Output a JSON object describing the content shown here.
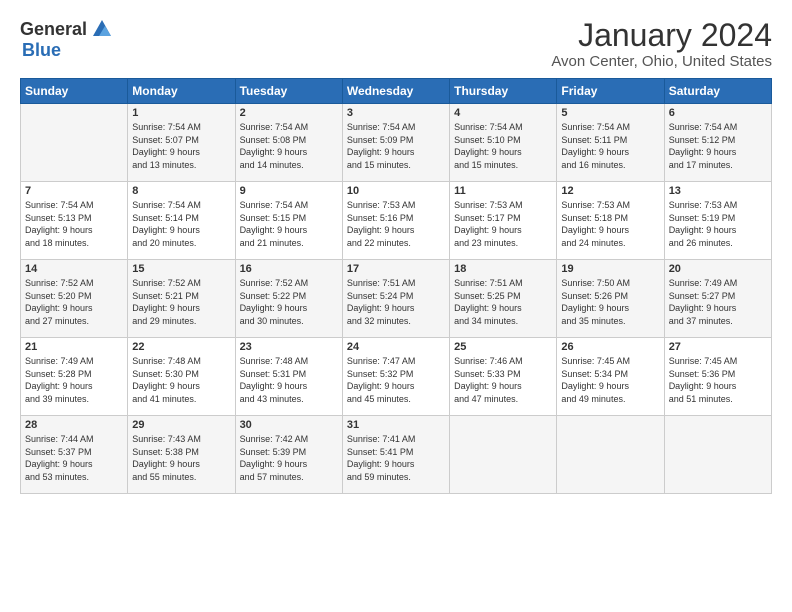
{
  "logo": {
    "general": "General",
    "blue": "Blue"
  },
  "title": "January 2024",
  "location": "Avon Center, Ohio, United States",
  "days_of_week": [
    "Sunday",
    "Monday",
    "Tuesday",
    "Wednesday",
    "Thursday",
    "Friday",
    "Saturday"
  ],
  "weeks": [
    [
      {
        "day": "",
        "sunrise": "",
        "sunset": "",
        "daylight": ""
      },
      {
        "day": "1",
        "sunrise": "Sunrise: 7:54 AM",
        "sunset": "Sunset: 5:07 PM",
        "daylight": "Daylight: 9 hours and 13 minutes."
      },
      {
        "day": "2",
        "sunrise": "Sunrise: 7:54 AM",
        "sunset": "Sunset: 5:08 PM",
        "daylight": "Daylight: 9 hours and 14 minutes."
      },
      {
        "day": "3",
        "sunrise": "Sunrise: 7:54 AM",
        "sunset": "Sunset: 5:09 PM",
        "daylight": "Daylight: 9 hours and 15 minutes."
      },
      {
        "day": "4",
        "sunrise": "Sunrise: 7:54 AM",
        "sunset": "Sunset: 5:10 PM",
        "daylight": "Daylight: 9 hours and 15 minutes."
      },
      {
        "day": "5",
        "sunrise": "Sunrise: 7:54 AM",
        "sunset": "Sunset: 5:11 PM",
        "daylight": "Daylight: 9 hours and 16 minutes."
      },
      {
        "day": "6",
        "sunrise": "Sunrise: 7:54 AM",
        "sunset": "Sunset: 5:12 PM",
        "daylight": "Daylight: 9 hours and 17 minutes."
      }
    ],
    [
      {
        "day": "7",
        "sunrise": "Sunrise: 7:54 AM",
        "sunset": "Sunset: 5:13 PM",
        "daylight": "Daylight: 9 hours and 18 minutes."
      },
      {
        "day": "8",
        "sunrise": "Sunrise: 7:54 AM",
        "sunset": "Sunset: 5:14 PM",
        "daylight": "Daylight: 9 hours and 20 minutes."
      },
      {
        "day": "9",
        "sunrise": "Sunrise: 7:54 AM",
        "sunset": "Sunset: 5:15 PM",
        "daylight": "Daylight: 9 hours and 21 minutes."
      },
      {
        "day": "10",
        "sunrise": "Sunrise: 7:53 AM",
        "sunset": "Sunset: 5:16 PM",
        "daylight": "Daylight: 9 hours and 22 minutes."
      },
      {
        "day": "11",
        "sunrise": "Sunrise: 7:53 AM",
        "sunset": "Sunset: 5:17 PM",
        "daylight": "Daylight: 9 hours and 23 minutes."
      },
      {
        "day": "12",
        "sunrise": "Sunrise: 7:53 AM",
        "sunset": "Sunset: 5:18 PM",
        "daylight": "Daylight: 9 hours and 24 minutes."
      },
      {
        "day": "13",
        "sunrise": "Sunrise: 7:53 AM",
        "sunset": "Sunset: 5:19 PM",
        "daylight": "Daylight: 9 hours and 26 minutes."
      }
    ],
    [
      {
        "day": "14",
        "sunrise": "Sunrise: 7:52 AM",
        "sunset": "Sunset: 5:20 PM",
        "daylight": "Daylight: 9 hours and 27 minutes."
      },
      {
        "day": "15",
        "sunrise": "Sunrise: 7:52 AM",
        "sunset": "Sunset: 5:21 PM",
        "daylight": "Daylight: 9 hours and 29 minutes."
      },
      {
        "day": "16",
        "sunrise": "Sunrise: 7:52 AM",
        "sunset": "Sunset: 5:22 PM",
        "daylight": "Daylight: 9 hours and 30 minutes."
      },
      {
        "day": "17",
        "sunrise": "Sunrise: 7:51 AM",
        "sunset": "Sunset: 5:24 PM",
        "daylight": "Daylight: 9 hours and 32 minutes."
      },
      {
        "day": "18",
        "sunrise": "Sunrise: 7:51 AM",
        "sunset": "Sunset: 5:25 PM",
        "daylight": "Daylight: 9 hours and 34 minutes."
      },
      {
        "day": "19",
        "sunrise": "Sunrise: 7:50 AM",
        "sunset": "Sunset: 5:26 PM",
        "daylight": "Daylight: 9 hours and 35 minutes."
      },
      {
        "day": "20",
        "sunrise": "Sunrise: 7:49 AM",
        "sunset": "Sunset: 5:27 PM",
        "daylight": "Daylight: 9 hours and 37 minutes."
      }
    ],
    [
      {
        "day": "21",
        "sunrise": "Sunrise: 7:49 AM",
        "sunset": "Sunset: 5:28 PM",
        "daylight": "Daylight: 9 hours and 39 minutes."
      },
      {
        "day": "22",
        "sunrise": "Sunrise: 7:48 AM",
        "sunset": "Sunset: 5:30 PM",
        "daylight": "Daylight: 9 hours and 41 minutes."
      },
      {
        "day": "23",
        "sunrise": "Sunrise: 7:48 AM",
        "sunset": "Sunset: 5:31 PM",
        "daylight": "Daylight: 9 hours and 43 minutes."
      },
      {
        "day": "24",
        "sunrise": "Sunrise: 7:47 AM",
        "sunset": "Sunset: 5:32 PM",
        "daylight": "Daylight: 9 hours and 45 minutes."
      },
      {
        "day": "25",
        "sunrise": "Sunrise: 7:46 AM",
        "sunset": "Sunset: 5:33 PM",
        "daylight": "Daylight: 9 hours and 47 minutes."
      },
      {
        "day": "26",
        "sunrise": "Sunrise: 7:45 AM",
        "sunset": "Sunset: 5:34 PM",
        "daylight": "Daylight: 9 hours and 49 minutes."
      },
      {
        "day": "27",
        "sunrise": "Sunrise: 7:45 AM",
        "sunset": "Sunset: 5:36 PM",
        "daylight": "Daylight: 9 hours and 51 minutes."
      }
    ],
    [
      {
        "day": "28",
        "sunrise": "Sunrise: 7:44 AM",
        "sunset": "Sunset: 5:37 PM",
        "daylight": "Daylight: 9 hours and 53 minutes."
      },
      {
        "day": "29",
        "sunrise": "Sunrise: 7:43 AM",
        "sunset": "Sunset: 5:38 PM",
        "daylight": "Daylight: 9 hours and 55 minutes."
      },
      {
        "day": "30",
        "sunrise": "Sunrise: 7:42 AM",
        "sunset": "Sunset: 5:39 PM",
        "daylight": "Daylight: 9 hours and 57 minutes."
      },
      {
        "day": "31",
        "sunrise": "Sunrise: 7:41 AM",
        "sunset": "Sunset: 5:41 PM",
        "daylight": "Daylight: 9 hours and 59 minutes."
      },
      {
        "day": "",
        "sunrise": "",
        "sunset": "",
        "daylight": ""
      },
      {
        "day": "",
        "sunrise": "",
        "sunset": "",
        "daylight": ""
      },
      {
        "day": "",
        "sunrise": "",
        "sunset": "",
        "daylight": ""
      }
    ]
  ]
}
